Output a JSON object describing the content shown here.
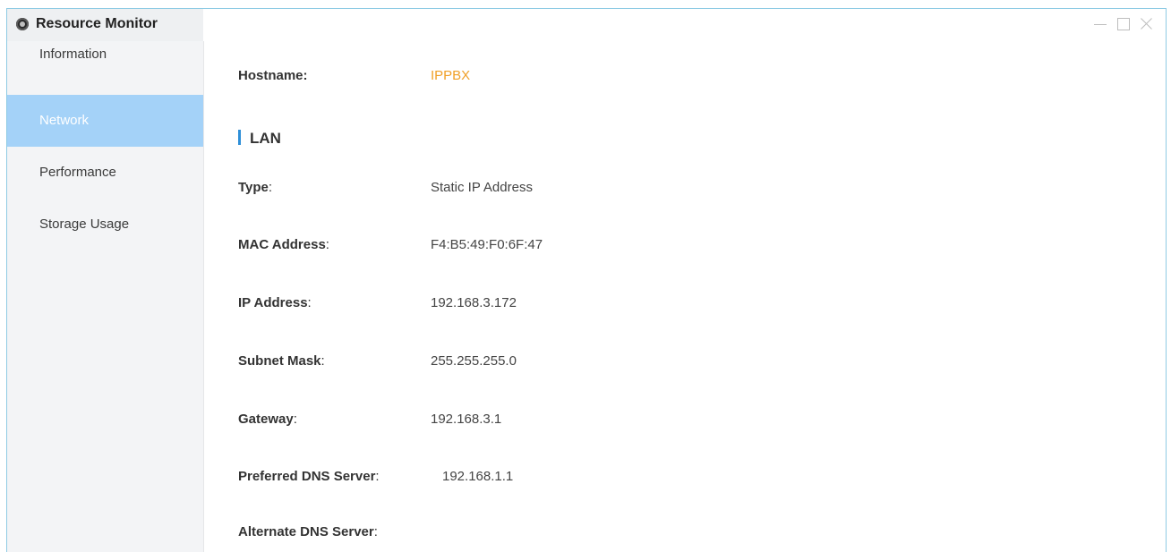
{
  "window": {
    "title": "Resource Monitor"
  },
  "sidebar": {
    "items": [
      {
        "label": "Information"
      },
      {
        "label": "Network"
      },
      {
        "label": "Performance"
      },
      {
        "label": "Storage Usage"
      }
    ],
    "active": "Network"
  },
  "main": {
    "hostname": {
      "label": "Hostname:",
      "value": "IPPBX"
    },
    "section_title": "LAN",
    "rows": [
      {
        "label": "Type",
        "value": "Static IP Address"
      },
      {
        "label": "MAC Address",
        "value": "F4:B5:49:F0:6F:47"
      },
      {
        "label": "IP Address",
        "value": "192.168.3.172"
      },
      {
        "label": "Subnet Mask",
        "value": "255.255.255.0"
      },
      {
        "label": "Gateway",
        "value": "192.168.3.1"
      },
      {
        "label": "Preferred DNS Server",
        "value": "192.168.1.1"
      },
      {
        "label": "Alternate DNS Server",
        "value": ""
      }
    ],
    "colon": ":"
  },
  "colors": {
    "accent": "#a4d2f8",
    "hostname": "#f0a028",
    "section_bar": "#2e8fd8"
  },
  "icons": {
    "app": "resource-monitor-icon",
    "minimize": "minimize-icon",
    "maximize": "maximize-icon",
    "close": "close-icon"
  }
}
